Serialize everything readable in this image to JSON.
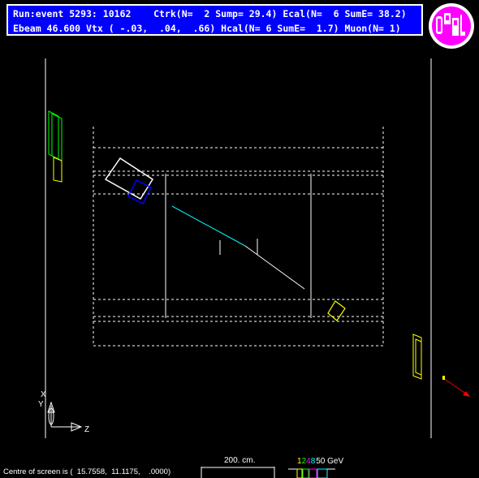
{
  "header": {
    "line1": "Run:event 5293: 10162    Ctrk(N=  2 Sump= 29.4) Ecal(N=  6 SumE= 38.2)",
    "line2": "Ebeam 46.600 Vtx ( -.03,  .04,  .66) Hcal(N= 6 SumE=  1.7) Muon(N= 1)"
  },
  "logo": {
    "text": "OPAL",
    "color": "#ff00ff"
  },
  "axes": {
    "x_label": "X",
    "y_label": "Y",
    "z_label": "Z"
  },
  "footer": {
    "centre_text": "Centre of screen is (  15.7558,  11.1175,    .0000)",
    "scale_label": "200. cm.",
    "energy_scale": [
      "1",
      "2",
      "4",
      "8",
      "50 GeV"
    ],
    "energy_colors": [
      "#ffff00",
      "#00ff00",
      "#ff00ff",
      "#00ffff",
      "#ffffff"
    ]
  }
}
